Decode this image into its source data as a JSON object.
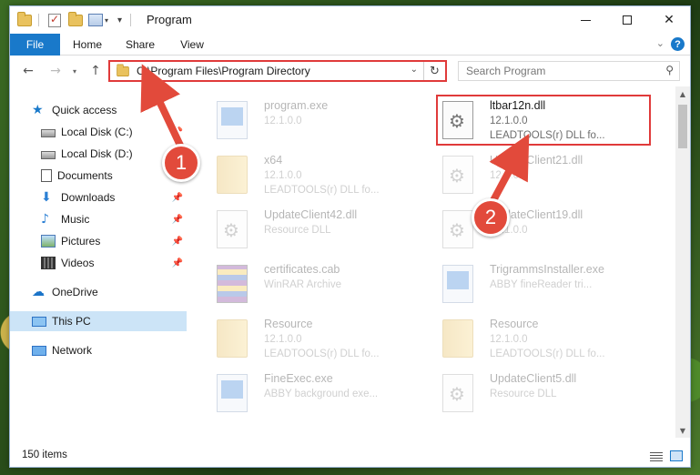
{
  "window": {
    "title": "Program",
    "close_glyph": "✕"
  },
  "ribbon": {
    "tabs": [
      "File",
      "Home",
      "Share",
      "View"
    ],
    "help_label": "?"
  },
  "nav": {
    "address": "C:\\Program Files\\Program Directory",
    "search_placeholder": "Search Program"
  },
  "sidebar": {
    "items": [
      {
        "label": "Quick access",
        "icon": "star-icon"
      },
      {
        "label": "Local Disk (C:)",
        "icon": "disk-icon",
        "pinned": true
      },
      {
        "label": "Local Disk (D:)",
        "icon": "disk-icon"
      },
      {
        "label": "Documents",
        "icon": "document-icon"
      },
      {
        "label": "Downloads",
        "icon": "download-icon",
        "pinned": true
      },
      {
        "label": "Music",
        "icon": "music-icon",
        "pinned": true
      },
      {
        "label": "Pictures",
        "icon": "picture-icon",
        "pinned": true
      },
      {
        "label": "Videos",
        "icon": "video-icon",
        "pinned": true
      },
      {
        "label": "OneDrive",
        "icon": "cloud-icon"
      },
      {
        "label": "This PC",
        "icon": "computer-icon",
        "selected": true
      },
      {
        "label": "Network",
        "icon": "network-icon"
      }
    ]
  },
  "files": [
    {
      "name": "program.exe",
      "line1": "12.1.0.0",
      "line2": "",
      "type": "exe",
      "faded": true
    },
    {
      "name": "ltbar12n.dll",
      "line1": "12.1.0.0",
      "line2": "LEADTOOLS(r) DLL fo...",
      "type": "dll",
      "faded": false,
      "highlighted": true
    },
    {
      "name": "x64",
      "line1": "12.1.0.0",
      "line2": "LEADTOOLS(r) DLL fo...",
      "type": "folder",
      "faded": true
    },
    {
      "name": "UpdateClient21.dll",
      "line1": "12.1.0.0",
      "line2": "",
      "type": "dll",
      "faded": true
    },
    {
      "name": "UpdateClient42.dll",
      "line1": "Resource DLL",
      "line2": "",
      "type": "dll",
      "faded": true
    },
    {
      "name": "UpdateClient19.dll",
      "line1": "12.1.0.0",
      "line2": "",
      "type": "dll",
      "faded": true
    },
    {
      "name": "certificates.cab",
      "line1": "WinRAR Archive",
      "line2": "",
      "type": "cab",
      "faded": true
    },
    {
      "name": "TrigrammsInstaller.exe",
      "line1": "ABBY fineReader tri...",
      "line2": "",
      "type": "exe",
      "faded": true
    },
    {
      "name": "Resource",
      "line1": "12.1.0.0",
      "line2": "LEADTOOLS(r) DLL fo...",
      "type": "folder",
      "faded": true
    },
    {
      "name": "Resource",
      "line1": "12.1.0.0",
      "line2": "LEADTOOLS(r) DLL fo...",
      "type": "folder",
      "faded": true
    },
    {
      "name": "FineExec.exe",
      "line1": "ABBY background exe...",
      "line2": "",
      "type": "exe",
      "faded": true
    },
    {
      "name": "UpdateClient5.dll",
      "line1": "Resource DLL",
      "line2": "",
      "type": "dll",
      "faded": true
    }
  ],
  "status": {
    "item_count": "150 items"
  },
  "annotations": {
    "step1": "1",
    "step2": "2",
    "color": "#e24a3b"
  }
}
